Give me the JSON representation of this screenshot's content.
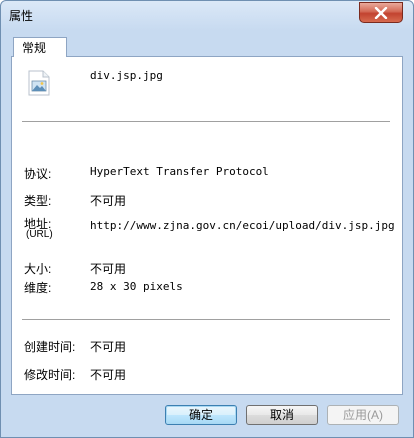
{
  "window": {
    "title": "属性",
    "close_icon": "close-icon"
  },
  "tab": {
    "label": "常规"
  },
  "file": {
    "name": "div.jsp.jpg",
    "icon": "image-file-icon"
  },
  "props": {
    "protocol_label": "协议:",
    "protocol_value": "HyperText Transfer Protocol",
    "type_label": "类型:",
    "type_value": "不可用",
    "address_label": "地址:",
    "address_sublabel": "(URL)",
    "address_value": "http://www.zjna.gov.cn/ecoi/upload/div.jsp.jpg",
    "size_label": "大小:",
    "size_value": "不可用",
    "dimensions_label": "维度:",
    "dimensions_value": "28 x 30 pixels",
    "created_label": "创建时间:",
    "created_value": "不可用",
    "modified_label": "修改时间:",
    "modified_value": "不可用"
  },
  "buttons": {
    "ok": "确定",
    "cancel": "取消",
    "apply": "应用(A)"
  },
  "colors": {
    "titlebar": "#c7daf0",
    "close": "#c24330",
    "panel_border": "#8ea5c3"
  }
}
